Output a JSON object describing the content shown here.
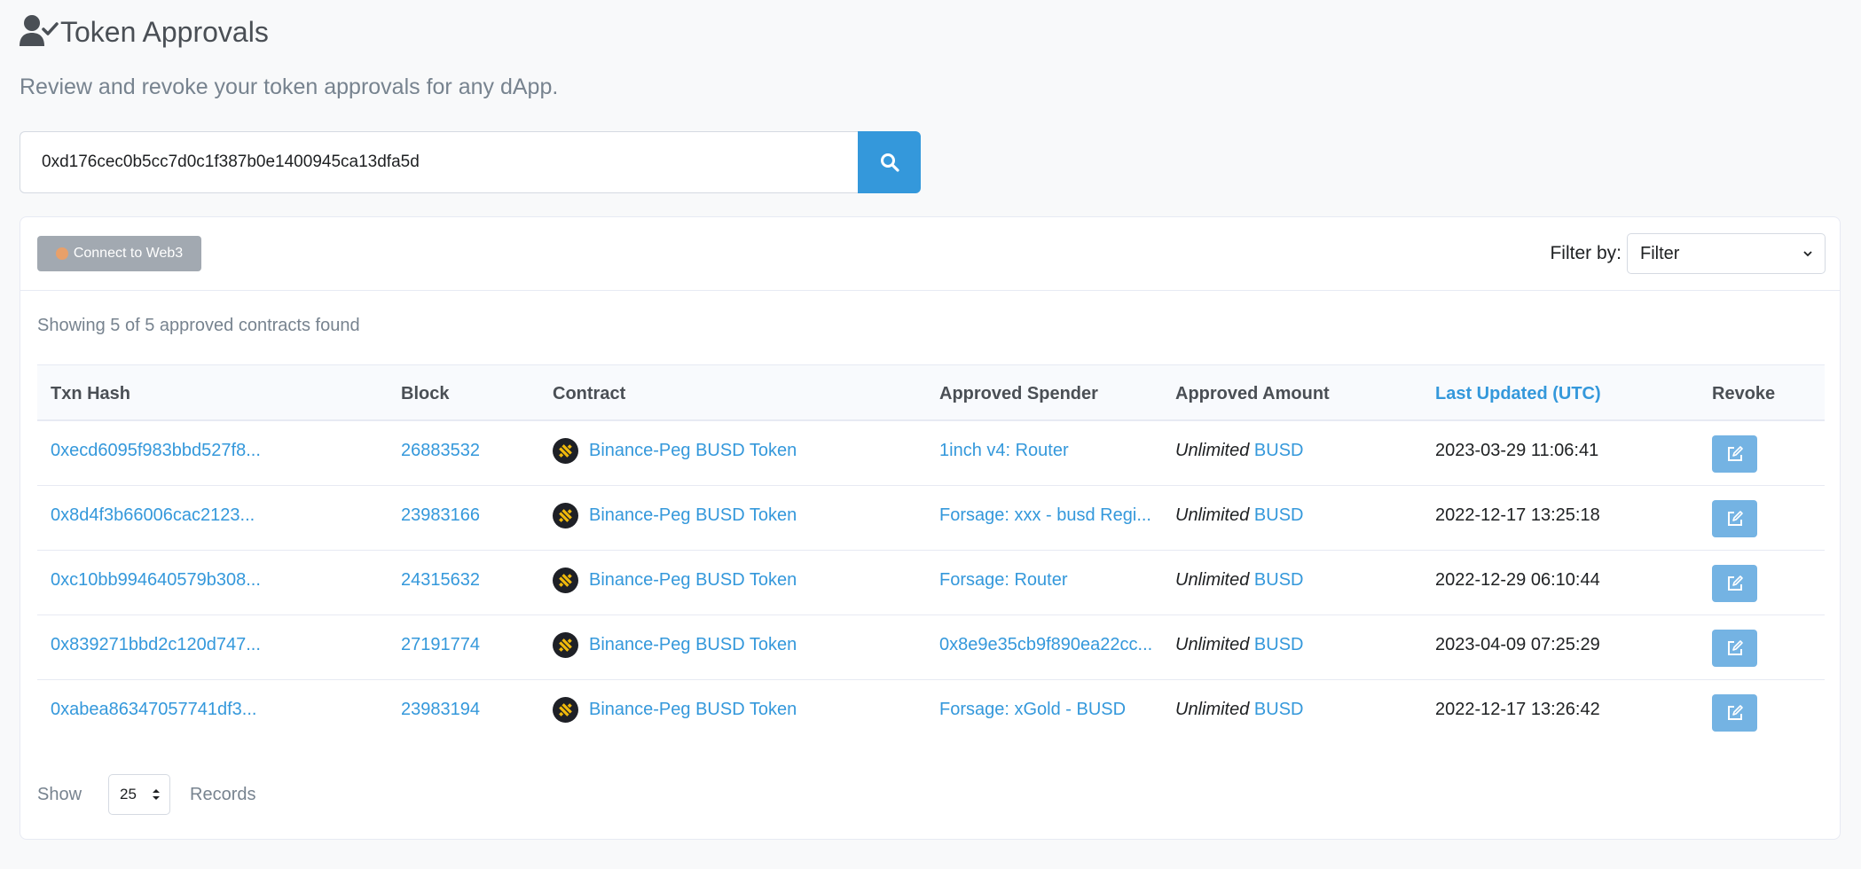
{
  "header": {
    "title": "Token Approvals",
    "subtitle": "Review and revoke your token approvals for any dApp.",
    "icon": "user-check-icon"
  },
  "search": {
    "value": "0xd176cec0b5cc7d0c1f387b0e1400945ca13dfa5d",
    "button_icon": "search-icon"
  },
  "toolbar": {
    "connect_label": "Connect to Web3",
    "filter_label": "Filter by:",
    "filter_value": "Filter"
  },
  "summary": "Showing 5 of 5 approved contracts found",
  "table": {
    "columns": [
      "Txn Hash",
      "Block",
      "Contract",
      "Approved Spender",
      "Approved Amount",
      "Last Updated (UTC)",
      "Revoke"
    ],
    "rows": [
      {
        "txn": "0xecd6095f983bbd527f8...",
        "block": "26883532",
        "contract": "Binance-Peg BUSD Token",
        "spender": "1inch v4: Router",
        "amount": "Unlimited",
        "token": "BUSD",
        "updated": "2023-03-29 11:06:41"
      },
      {
        "txn": "0x8d4f3b66006cac2123...",
        "block": "23983166",
        "contract": "Binance-Peg BUSD Token",
        "spender": "Forsage: xxx - busd Regi...",
        "amount": "Unlimited",
        "token": "BUSD",
        "updated": "2022-12-17 13:25:18"
      },
      {
        "txn": "0xc10bb994640579b308...",
        "block": "24315632",
        "contract": "Binance-Peg BUSD Token",
        "spender": "Forsage: Router",
        "amount": "Unlimited",
        "token": "BUSD",
        "updated": "2022-12-29 06:10:44"
      },
      {
        "txn": "0x839271bbd2c120d747...",
        "block": "27191774",
        "contract": "Binance-Peg BUSD Token",
        "spender": "0x8e9e35cb9f890ea22cc...",
        "amount": "Unlimited",
        "token": "BUSD",
        "updated": "2023-04-09 07:25:29"
      },
      {
        "txn": "0xabea86347057741df3...",
        "block": "23983194",
        "contract": "Binance-Peg BUSD Token",
        "spender": "Forsage: xGold - BUSD",
        "amount": "Unlimited",
        "token": "BUSD",
        "updated": "2022-12-17 13:26:42"
      }
    ]
  },
  "footer": {
    "show_label": "Show",
    "page_size": "25",
    "records_label": "Records"
  },
  "colors": {
    "accent": "#3498db",
    "revoke": "#74b3e3",
    "token_icon_bg": "#1e2026",
    "token_icon_fg": "#f0b90b"
  }
}
